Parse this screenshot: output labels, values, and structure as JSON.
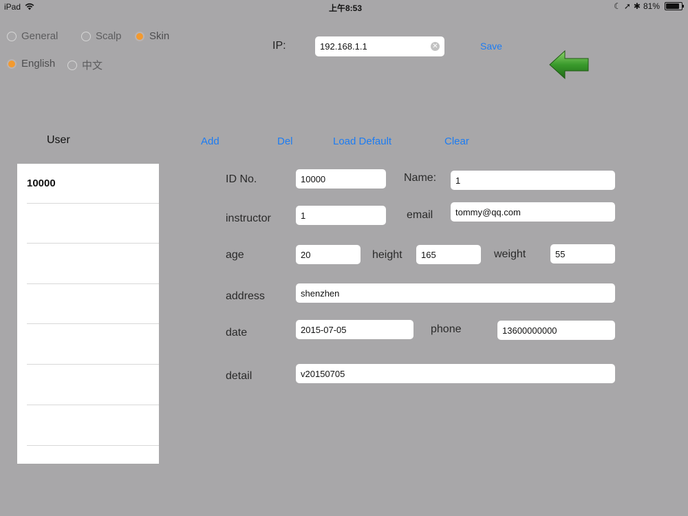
{
  "status_bar": {
    "device": "iPad",
    "time": "上午8:53",
    "battery_text": "81%",
    "battery_level": 0.81
  },
  "mode_options": [
    {
      "label": "General",
      "selected": false
    },
    {
      "label": "Scalp",
      "selected": false
    },
    {
      "label": "Skin",
      "selected": true
    }
  ],
  "language_options": [
    {
      "label": "English",
      "selected": true
    },
    {
      "label": "中文",
      "selected": false
    }
  ],
  "ip": {
    "label": "IP:",
    "value": "192.168.1.1"
  },
  "save_label": "Save",
  "accent_color": "#1d7cf2",
  "radio_selected_color": "#f39a2f",
  "arrow_color": "#3a9a2c",
  "toolbar": {
    "user_title": "User",
    "add": "Add",
    "del": "Del",
    "load_default": "Load Default",
    "clear": "Clear"
  },
  "user_list": [
    "10000",
    "",
    "",
    "",
    "",
    "",
    "",
    ""
  ],
  "form": {
    "id_label": "ID No.",
    "id_value": "10000",
    "name_label": "Name:",
    "name_value": "1",
    "instructor_label": "instructor",
    "instructor_value": "1",
    "email_label": "email",
    "email_value": "tommy@qq.com",
    "age_label": "age",
    "age_value": "20",
    "height_label": "height",
    "height_value": "165",
    "weight_label": "weight",
    "weight_value": "55",
    "address_label": "address",
    "address_value": "shenzhen",
    "date_label": "date",
    "date_value": "2015-07-05",
    "phone_label": "phone",
    "phone_value": "13600000000",
    "detail_label": "detail",
    "detail_value": "v20150705"
  }
}
